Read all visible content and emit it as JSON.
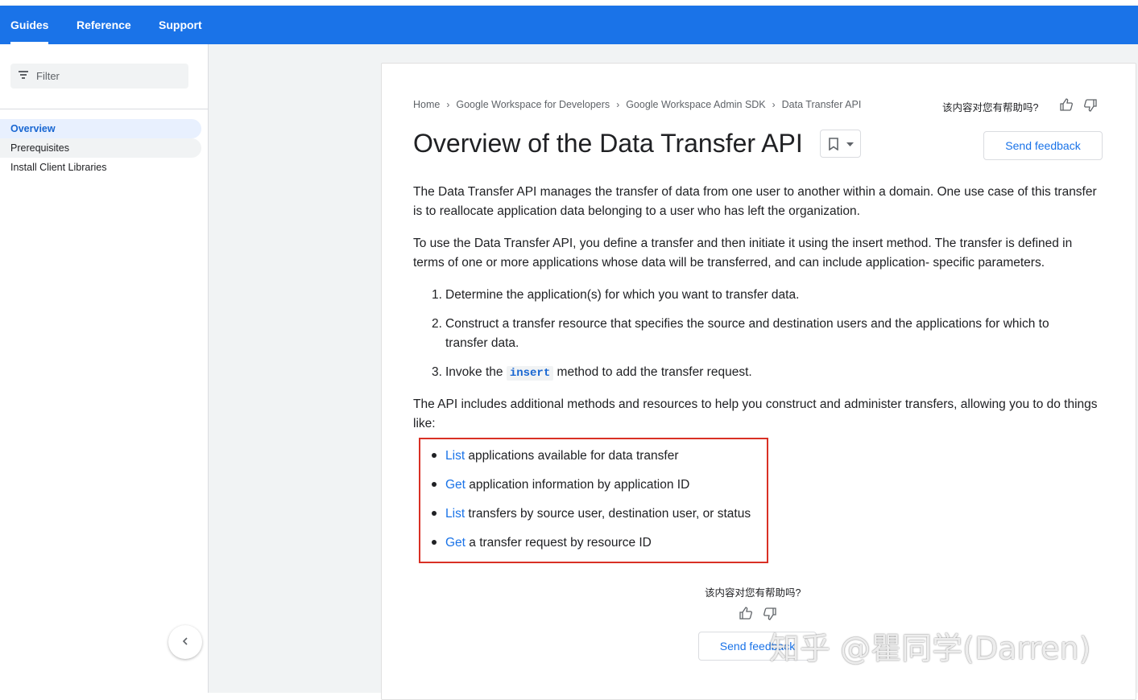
{
  "header": {
    "tabs": [
      {
        "label": "Guides",
        "active": true
      },
      {
        "label": "Reference",
        "active": false
      },
      {
        "label": "Support",
        "active": false
      }
    ],
    "brand_color": "#1a73e8"
  },
  "sidebar": {
    "filter_placeholder": "Filter",
    "items": [
      {
        "label": "Overview",
        "active": true
      },
      {
        "label": "Prerequisites",
        "active": false
      },
      {
        "label": "Install Client Libraries",
        "active": false
      }
    ]
  },
  "breadcrumb": [
    "Home",
    "Google Workspace for Developers",
    "Google Workspace Admin SDK",
    "Data Transfer API"
  ],
  "helpful_prompt": "该内容对您有帮助吗?",
  "page": {
    "title": "Overview of the Data Transfer API",
    "send_feedback": "Send feedback",
    "intro1": "The Data Transfer API manages the transfer of data from one user to another within a domain. One use case of this transfer is to reallocate application data belonging to a user who has left the organization.",
    "intro2": "To use the Data Transfer API, you define a transfer and then initiate it using the insert method. The transfer is defined in terms of one or more applications whose data will be transferred, and can include application- specific parameters.",
    "steps": [
      {
        "num": "1.",
        "text": "Determine the application(s) for which you want to transfer data."
      },
      {
        "num": "2.",
        "text": "Construct a transfer resource that specifies the source and destination users and the applications for which to transfer data."
      },
      {
        "num": "3.",
        "prefix": "Invoke the ",
        "code": "insert",
        "suffix": " method to add the transfer request."
      }
    ],
    "methods_intro": "The API includes additional methods and resources to help you construct and administer transfers, allowing you to do things like:",
    "methods": [
      {
        "link": "List",
        "text": " applications available for data transfer"
      },
      {
        "link": "Get",
        "text": " application information by application ID"
      },
      {
        "link": "List",
        "text": " transfers by source user, destination user, or status"
      },
      {
        "link": "Get",
        "text": " a transfer request by resource ID"
      }
    ],
    "highlight_color": "#d93025"
  },
  "footer": {
    "helpful_prompt": "该内容对您有帮助吗?",
    "send_feedback": "Send feedback"
  },
  "watermark": "知乎 @瞿同学(Darren)"
}
